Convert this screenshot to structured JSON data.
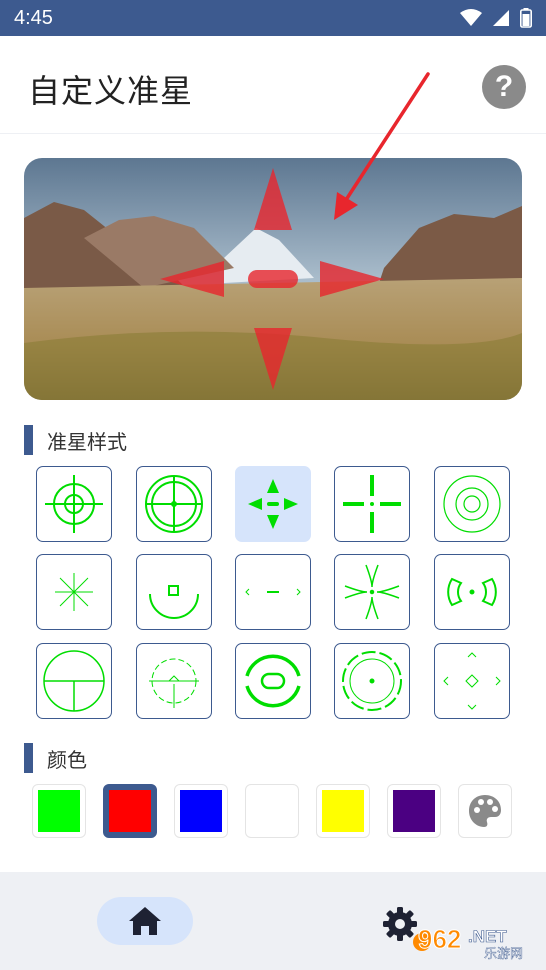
{
  "status_bar": {
    "time": "4:45"
  },
  "header": {
    "title": "自定义准星",
    "help_label": "?"
  },
  "preview": {
    "description_icon": "crosshair-preview-image"
  },
  "styles_section": {
    "title": "准星样式",
    "selected_index": 2
  },
  "colors_section": {
    "title": "颜色",
    "swatches": [
      "#00ff00",
      "#ff0000",
      "#0000ff",
      "#ffffff",
      "#ffff00",
      "#4b0082"
    ],
    "selected_index": 1,
    "custom_icon": "palette-icon"
  },
  "bottom_nav": {
    "home_icon": "home-icon",
    "settings_icon": "gear-icon"
  },
  "watermark": {
    "brand": "962",
    "domain_suffix": ".NET",
    "sub": "乐游网"
  },
  "accent_color": "#3d5a8f"
}
